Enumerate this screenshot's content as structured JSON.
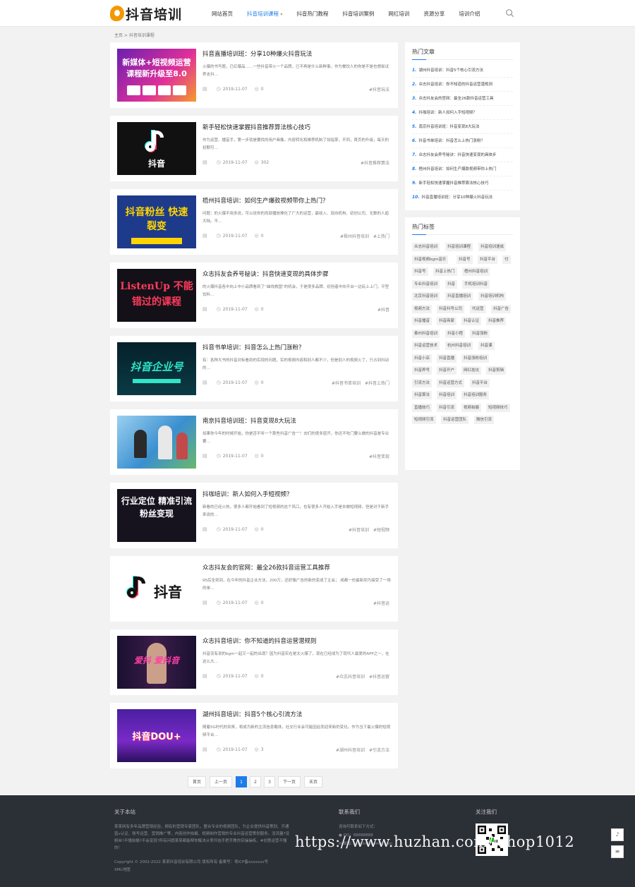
{
  "header": {
    "logo_text": "抖音培训",
    "nav": [
      "网站首页",
      "抖音培训课程",
      "抖音热门教程",
      "抖音培训案例",
      "网红培训",
      "资源分享",
      "培训介绍"
    ]
  },
  "breadcrumb": "主页 > 抖音培训课程",
  "articles": [
    {
      "title": "抖音直播培训班：分享10种爆火抖音玩法",
      "excerpt": "火爆的书写题，已红爆品……一些抖音带火一个品牌，已不再是什么新鲜事。作为餐饮人的你是不是也想尝试养支抖…",
      "date": "2019-11-07",
      "views": "0",
      "tags": [
        "#抖音玩法"
      ],
      "thumb": "新媒体+短视频运营 课程新升级至8.0"
    },
    {
      "title": "新手轻松快速掌握抖音推荐算法核心技巧",
      "excerpt": "作为运营、播音手，第一步就是要找的用户画像。内容转化和推荐机制了如指掌，不同，首页的升级，每天的初期可…",
      "date": "2019-11-07",
      "views": "302",
      "tags": [
        "#抖音推荐算法"
      ],
      "thumb": "抖音"
    },
    {
      "title": "梧州抖音培训：如何生产爆款视频带你上热门？",
      "excerpt": "问题：的火爆不用多说，可以说你的尚部播放捧化了广大的运营，最收入、双向机构、初创公司、无数的人趋大陆。不…",
      "date": "2019-11-07",
      "views": "0",
      "tags": [
        "#梧州抖音培训",
        "#上热门"
      ],
      "thumb": "抖音粉丝 快速裂变"
    },
    {
      "title": "众志抖友会养号秘诀：抖音快速变现的具体步骤",
      "excerpt": "的火爆抖音各中向上中小品牌看到了“曲线救国”的机会，于是很多品牌、初创者中向平台一边玩上上门，平型饮料…",
      "date": "2019-11-07",
      "views": "0",
      "tags": [
        "#抖音"
      ],
      "thumb": "ListenUp 不能错过的课程"
    },
    {
      "title": "抖音书单培训：抖音怎么上热门涨粉？",
      "excerpt": "有：各种大书的抖音对标看到的实现的问题，实的视频内容和别人都不少，但是别人的视频火了，只占到抖动的…",
      "date": "2019-11-07",
      "views": "0",
      "tags": [
        "#抖音书单培训",
        "#抖音上热门"
      ],
      "thumb": "抖音企业号"
    },
    {
      "title": "南京抖音培训班：抖音变现8大玩法",
      "excerpt": "如果你今年的时候开始，你是否不听一个那些抖音广告“”！去们的很多层开，你还不吃门要么做的抖音是专业要…",
      "date": "2019-11-07",
      "views": "0",
      "tags": [
        "#抖音变现"
      ],
      "thumb": ""
    },
    {
      "title": "抖咖培训：新人如何入手短视频？",
      "excerpt": "新看的已经火热，很多人都开始看到了短视频的这个风口，也有很多人开始入手是去做短视频，但是对于新手来说的…",
      "date": "2019-11-07",
      "views": "0",
      "tags": [
        "#抖音培训",
        "#短视频"
      ],
      "thumb": "行业定位 精准引流 粉丝变现"
    },
    {
      "title": "众志抖友会的官网：最全26款抖音运营工具推荐",
      "excerpt": "95后全到到，在今年的抖音企业方法，200万，还好像广告的新的变成了主会； 成都一份最新到为接受了一场的单…",
      "date": "2019-11-07",
      "views": "0",
      "tags": [
        "#抖音运"
      ],
      "thumb": "抖音"
    },
    {
      "title": "众志抖音培训：你不知道的抖音运营潜规则",
      "excerpt": "抖音没有说的bgm一起又一起的出现？因为抖音实在是太火爆了，现在已经成为了现代人最爱的APP之一，在这么大…",
      "date": "2019-11-07",
      "views": "0",
      "tags": [
        "#众志抖音培训",
        "#抖音运营"
      ],
      "thumb": "爱抖 爱抖音"
    },
    {
      "title": "湖州抖音培训：抖音5个核心引流方法",
      "excerpt": "随着5G时代的到来，将成为新的主流信息载体，社交行业会可能因此而迎来新的变化。作为当下最火爆的短视频平台…",
      "date": "2019-11-07",
      "views": "3",
      "tags": [
        "#湖州抖音培训",
        "#引流方法"
      ],
      "thumb": "抖音DOU+"
    }
  ],
  "hot_articles": {
    "title": "热门文章",
    "items": [
      "湖州抖音培训：抖音5个核心引流方法",
      "众志抖音培训：你不知道的抖音运营潜规则",
      "众志抖友会的官网：最全26款抖音运营工具",
      "抖咖培训：新人如何入手短视频？",
      "南京抖音培训班：抖音变现8大玩法",
      "抖音书单培训：抖音怎么上热门涨粉？",
      "众志抖友会养号秘诀：抖音快速变现的具体步",
      "梧州抖音培训：如何生产爆款视频带你上热门",
      "新手轻松快速掌握抖音推荐算法核心技巧",
      "抖音直播培训班：分享10种爆火抖音玩法"
    ]
  },
  "hot_tags": {
    "title": "热门标签",
    "items": [
      "众志抖音培训",
      "抖音培训课程",
      "抖音培训速成",
      "抖音视频bgm音乐",
      "抖音号",
      "抖音平台",
      "付",
      "抖音号",
      "抖音上热门",
      "梧州抖音培训",
      "专业抖音培训",
      "抖音",
      "手机培训抖音",
      "北京抖音培训",
      "抖音直播培训",
      "抖音培训机构",
      "视频方法",
      "抖音抖号公司",
      "代运营",
      "抖音广告",
      "抖音播音",
      "抖音商家",
      "抖音认证",
      "抖音推荐",
      "泰州抖音培训",
      "抖音小程",
      "抖音涨粉",
      "抖音运营技术",
      "杭州抖音培训",
      "抖音课",
      "抖音小店",
      "抖音直播",
      "抖音涨粉培训",
      "抖音养号",
      "抖音开户",
      "网红挂坑",
      "抖音剪辑",
      "引流方法",
      "抖音运营方式",
      "抖音平台",
      "抖音算法",
      "抖音培训",
      "抖音培训服务",
      "直播技巧",
      "抖音引流",
      "视频拍摄",
      "短视频技巧",
      "短视频引流",
      "抖音运营团队",
      "微信引流"
    ]
  },
  "pagination": [
    "首页",
    "上一页",
    "1",
    "2",
    "3",
    "下一页",
    "末页"
  ],
  "footer": {
    "about_title": "关于本站",
    "about_text": "某某网有多年品牌营销经验，拥有的营销专家团队，整合专业的视频团队，为企业提供抖音策划、开通蓝v认证、账号运营、营销推广等，内容创作拍摄、视频制作营销的专业抖音运营策划服务。没流量?没粉丝?不懂拍摄?不会变现?所有问题某某都能帮你解决从零开始手把手教你实操操练，#创意运营不懂的！",
    "copyright": "Copyright © 2002-2022 某某抖音培训有限公司 版权所有 备案号：粤ICP备xxxxxxx号",
    "sitemap": "XML地图",
    "contact_title": "联系我们",
    "contact_text": "咨询可联系如下方式：",
    "contact_qq": "QQ：88888888",
    "contact_email": "邮箱：admin@admin.com",
    "follow_title": "关注我们"
  },
  "watermark": "https://www.huzhan.com/ishop1012",
  "colors": {
    "accent": "#1e7ce8",
    "footer_bg": "#2b2f36",
    "logo": "#f39800"
  }
}
